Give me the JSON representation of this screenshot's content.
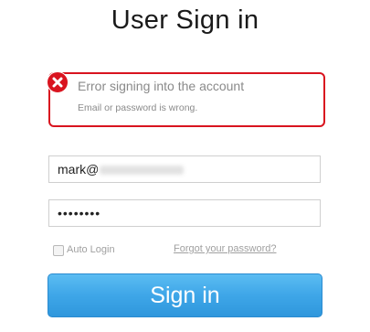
{
  "page": {
    "title": "User Sign in"
  },
  "error": {
    "title": "Error signing into the account",
    "detail": "Email or password is wrong.",
    "icon": "error-x-icon",
    "color": "#d9141f"
  },
  "form": {
    "email_value_visible": "mark@",
    "password_value": "••••••••",
    "auto_login_label": "Auto Login",
    "forgot_link": "Forgot your password?",
    "submit_label": "Sign in"
  },
  "colors": {
    "button": "#3ea6e8",
    "error": "#d9141f"
  }
}
